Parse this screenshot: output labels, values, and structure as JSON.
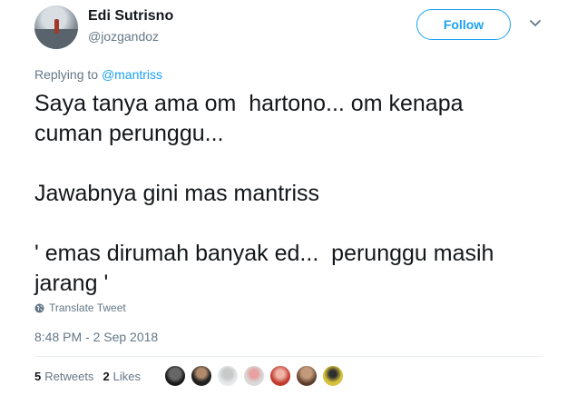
{
  "author": {
    "name": "Edi Sutrisno",
    "handle": "@jozgandoz"
  },
  "follow_label": "Follow",
  "reply": {
    "prefix": "Replying to ",
    "mention": "@mantriss"
  },
  "tweet_text": "Saya tanya ama om  hartono... om kenapa\ncuman perunggu...\n\nJawabnya gini mas mantriss\n\n' emas dirumah banyak ed...  perunggu masih\njarang '",
  "translate_label": "Translate Tweet",
  "timestamp": "8:48 PM - 2 Sep 2018",
  "stats": {
    "retweets_count": "5",
    "retweets_label": "Retweets",
    "likes_count": "2",
    "likes_label": "Likes"
  },
  "colors": {
    "accent": "#1da1f2",
    "secondary_text": "#657786",
    "primary_text": "#14171a"
  },
  "icons": [
    "chevron-down-icon",
    "globe-icon"
  ]
}
